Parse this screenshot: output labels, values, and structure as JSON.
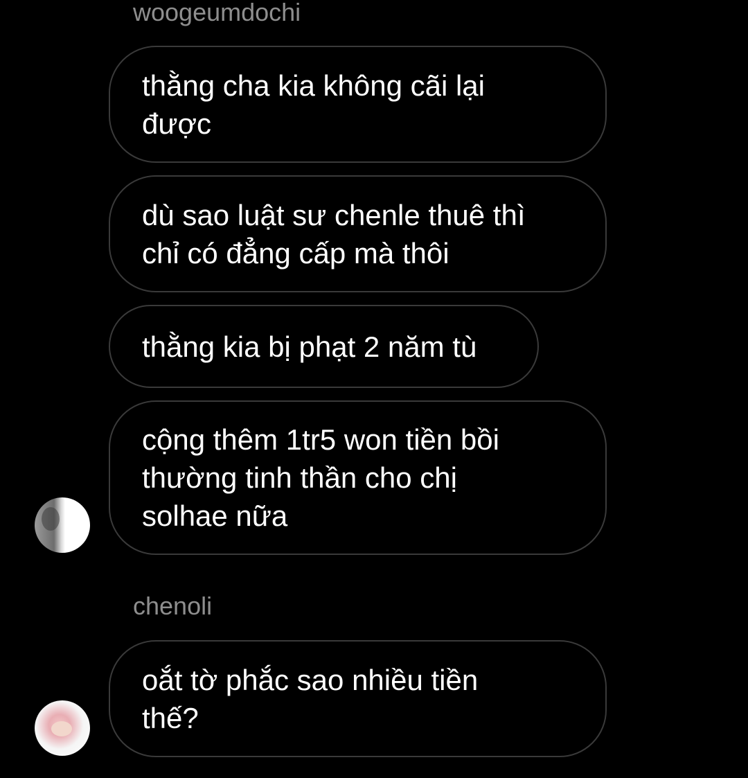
{
  "conversation": {
    "groups": [
      {
        "sender": "woogeumdochi",
        "messages": [
          "thằng cha kia không cãi lại\nđược",
          "dù sao luật sư chenle thuê thì\nchỉ có đẳng cấp mà thôi",
          "thằng kia bị phạt 2 năm tù",
          "cộng thêm 1tr5 won tiền bồi\nthường tinh thần cho chị\nsolhae nữa"
        ],
        "avatar_icon": "profile-photo-icon"
      },
      {
        "sender": "chenoli",
        "messages": [
          "oắt tờ phắc sao nhiều tiền\nthế?"
        ],
        "avatar_icon": "profile-photo-icon"
      }
    ]
  },
  "colors": {
    "background": "#000000",
    "bubble_border": "#3a3a3a",
    "sender_name": "#8e8e8e",
    "text": "#ffffff"
  }
}
